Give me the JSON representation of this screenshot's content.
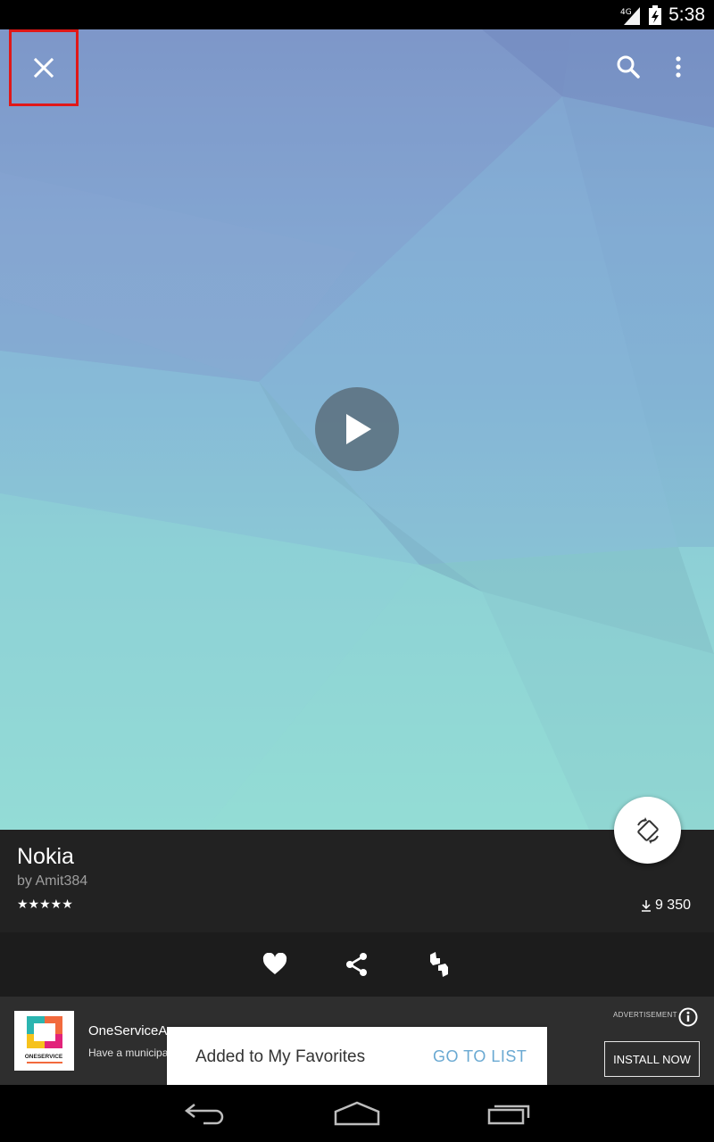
{
  "status_bar": {
    "network": "4G",
    "time": "5:38"
  },
  "toolbar": {
    "close_icon": "close-icon",
    "search_icon": "search-icon",
    "more_icon": "more-vert-icon"
  },
  "preview": {
    "play_icon": "play-icon",
    "rotate_icon": "screen-rotation-icon"
  },
  "wallpaper": {
    "title": "Nokia",
    "author": "by Amit384",
    "rating": "★★★★★",
    "downloads": "9 350"
  },
  "actions": [
    {
      "name": "favorite",
      "icon": "heart-icon"
    },
    {
      "name": "share",
      "icon": "share-icon"
    },
    {
      "name": "report",
      "icon": "thumbs-icon"
    }
  ],
  "ad": {
    "logo_text": "ONESERVICE",
    "title": "OneServiceApp",
    "description": "Have a municipal issue?",
    "label": "ADVERTISEMENT",
    "install_label": "INSTALL NOW"
  },
  "toast": {
    "message": "Added to My Favorites",
    "action": "GO TO LIST"
  },
  "colors": {
    "accent": "#6aa9d2",
    "highlight_box": "#e01818",
    "panel": "#222222"
  }
}
